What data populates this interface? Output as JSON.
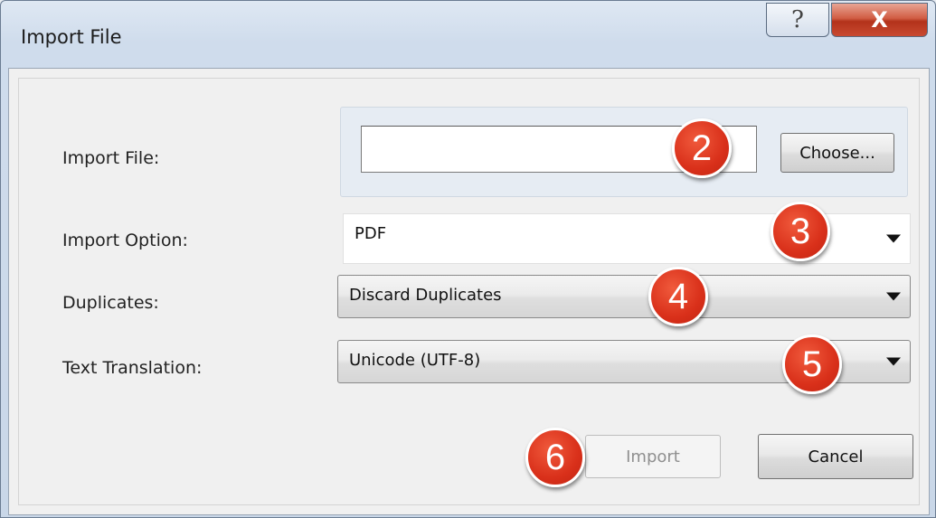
{
  "window": {
    "title": "Import File",
    "help_icon": "?",
    "close_icon": "X"
  },
  "form": {
    "file_label": "Import File:",
    "file_value": "",
    "choose_label": "Choose...",
    "option_label": "Import Option:",
    "option_value": "PDF",
    "duplicates_label": "Duplicates:",
    "duplicates_value": "Discard Duplicates",
    "translation_label": "Text Translation:",
    "translation_value": "Unicode (UTF-8)",
    "import_label": "Import",
    "cancel_label": "Cancel"
  },
  "badges": [
    "2",
    "3",
    "4",
    "5",
    "6"
  ],
  "colors": {
    "badge": "#d9301a",
    "close_button": "#c94a30",
    "disabled_text": "#8f8f8f"
  }
}
